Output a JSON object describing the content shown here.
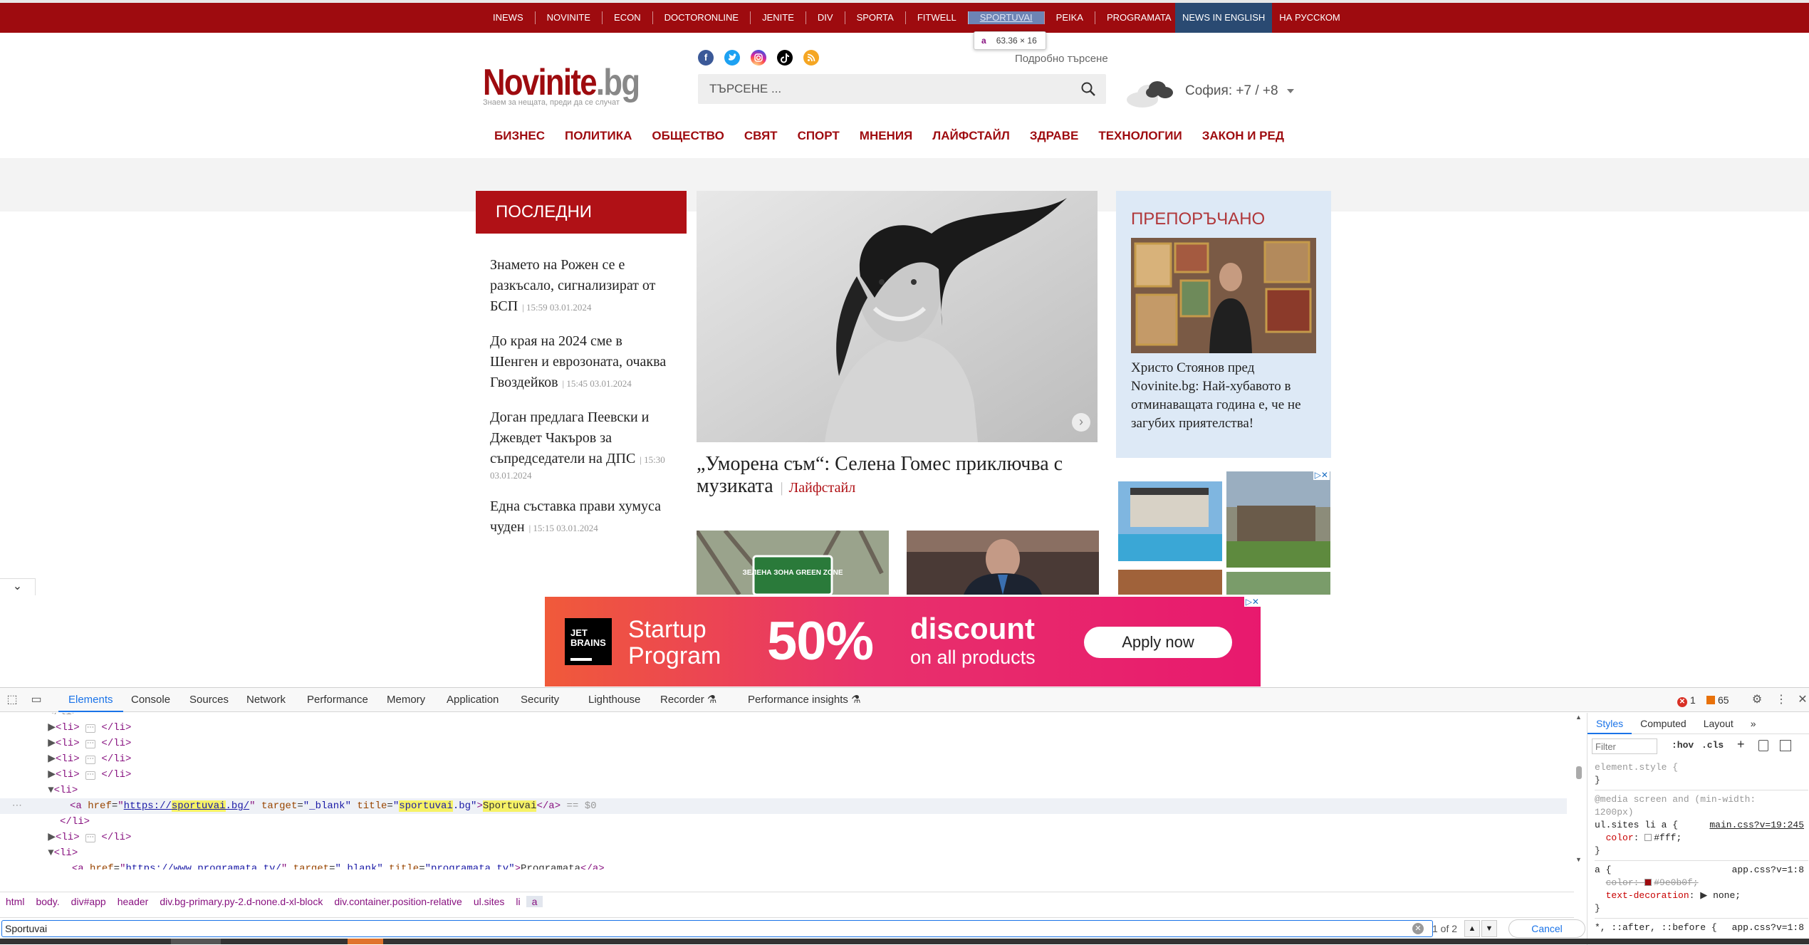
{
  "site": {
    "top_sites": [
      "INEWS",
      "NOVINITE",
      "ECON",
      "DOCTORONLINE",
      "JENITE",
      "DIV",
      "SPORTA",
      "FITWELL",
      "SPORTUVAI",
      "PEIKA",
      "PROGRAMATA"
    ],
    "lang_en": "NEWS IN ENGLISH",
    "lang_ru": "НА РУССКОМ",
    "tooltip": {
      "tag": "a",
      "dims": "63.36 × 16"
    },
    "logo_main": "Novinite",
    "logo_suffix": ".bg",
    "logo_tagline": "Знаем за нещата, преди да се случат",
    "social": [
      "facebook-icon",
      "twitter-icon",
      "instagram-icon",
      "tiktok-icon",
      "rss-icon"
    ],
    "advanced_search": "Подробно търсене",
    "search_placeholder": "ТЪРСЕНЕ ...",
    "weather": "София: +7 / +8",
    "main_nav": [
      "БИЗНЕС",
      "ПОЛИТИКА",
      "ОБЩЕСТВО",
      "СВЯТ",
      "СПОРТ",
      "МНЕНИЯ",
      "ЛАЙФСТАЙЛ",
      "ЗДРАВЕ",
      "ТЕХНОЛОГИИ",
      "ЗАКОН И РЕД"
    ],
    "latest_title": "ПОСЛЕДНИ",
    "latest": [
      {
        "title": "Знамето на Рожен се е разкъсало, сигнализират от БСП",
        "time": "| 15:59 03.01.2024"
      },
      {
        "title": "До края на 2024 сме в Шенген и еврозоната, очаква Гвоздейков",
        "time": "| 15:45 03.01.2024"
      },
      {
        "title": "Доган предлага Пеевски и Джевдет Чакъров за съпредседатели на ДПС",
        "time": "| 15:30 03.01.2024"
      },
      {
        "title": "Една съставка прави хумуса чуден",
        "time": "| 15:15 03.01.2024"
      }
    ],
    "hero_title": "„Уморена съм“: Селена Гомес приключва с музиката",
    "hero_category": "Лайфстайл",
    "thumb_sign": "ЗЕЛЕНА ЗОНА GREEN ZONE",
    "recommended_title": "ПРЕПОРЪЧАНО",
    "recommended_caption": "Христо Стоянов пред Novinite.bg: Най-хубавото в отминаващата година е, че не загубих приятелства!",
    "banner": {
      "brand": "JET BRAINS",
      "program": "Startup Program",
      "percent": "50%",
      "discount": "discount",
      "on_all": "on all products",
      "cta": "Apply now"
    }
  },
  "devtools": {
    "tabs": [
      "Elements",
      "Console",
      "Sources",
      "Network",
      "Performance",
      "Memory",
      "Application",
      "Security",
      "Lighthouse",
      "Recorder",
      "Performance insights"
    ],
    "active_tab": "Elements",
    "errors": "1",
    "warnings": "65",
    "code": {
      "li_collapsed": "<li>",
      "li_close": "</li>",
      "a_href": "https://sportuvai.bg/",
      "a_target": "_blank",
      "a_title": "sportuvai.bg",
      "a_text": "Sportuvai",
      "eq0": "== $0",
      "a2_href": "https://www.programata.tv/",
      "a2_title": "programata.tv",
      "a2_text": "Programata"
    },
    "breadcrumbs": [
      "html",
      "body.",
      "div#app",
      "header",
      "div.bg-primary.py-2.d-none.d-xl-block",
      "div.container.position-relative",
      "ul.sites",
      "li",
      "a"
    ],
    "find_value": "Sportuvai",
    "find_count": "1 of 2",
    "cancel": "Cancel",
    "styles_tabs": [
      "Styles",
      "Computed",
      "Layout"
    ],
    "filter_placeholder": "Filter",
    "hov": ":hov",
    "cls": ".cls",
    "rules": {
      "element_style": "element.style {",
      "media": "@media screen and (min-width: 1200px)",
      "sel1": "ul.sites li a {",
      "src1": "main.css?v=19:245",
      "prop1": "color",
      "val1": "#fff;",
      "sel2": "a {",
      "src2": "app.css?v=1:8",
      "prop2": "color",
      "val2": "#9e0b0f;",
      "prop3": "text-decoration",
      "val3": "none;",
      "sel3": "*, ::after, ::before {",
      "src3": "app.css?v=1:8"
    }
  },
  "colors": {
    "brand_red": "#9e0b0f",
    "accent_blue": "#1a73e8"
  }
}
